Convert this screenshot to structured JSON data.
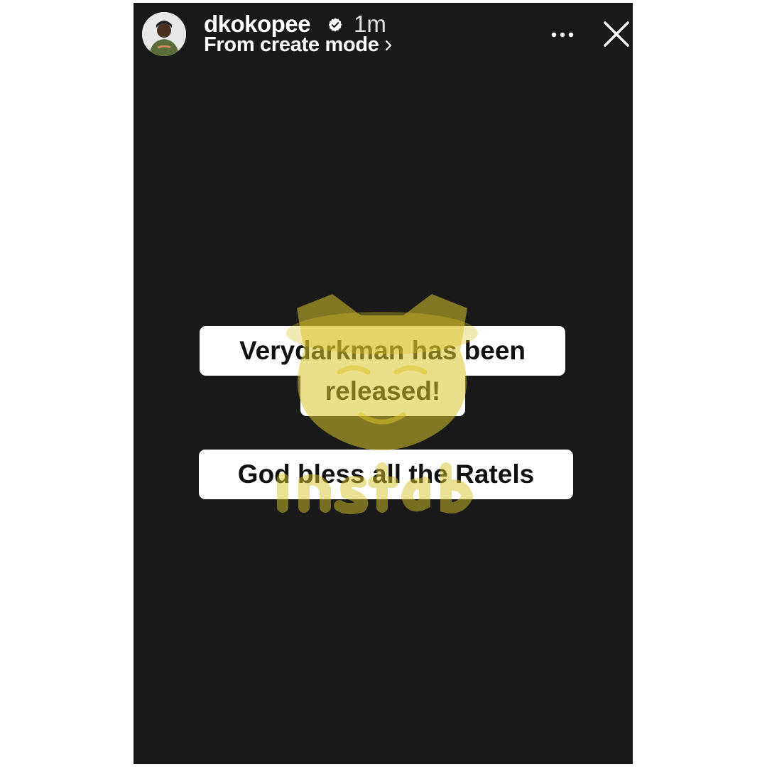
{
  "header": {
    "username": "dkokopee",
    "time": "1m",
    "subtitle": "From create mode"
  },
  "story": {
    "lines": [
      "Verydarkman has been",
      "released!",
      "God bless all the Ratels"
    ]
  },
  "icons": {
    "verified": "verified-badge-icon",
    "subtitle_chevron": "chevron-right-icon",
    "more": "more-options-icon",
    "close": "close-icon"
  },
  "watermark": "instablog9ja",
  "colors": {
    "story_background": "#191919",
    "page_background": "#ffffff",
    "sticker_background": "#ffffff",
    "sticker_text": "#111111",
    "watermark": "#d8c42a"
  }
}
